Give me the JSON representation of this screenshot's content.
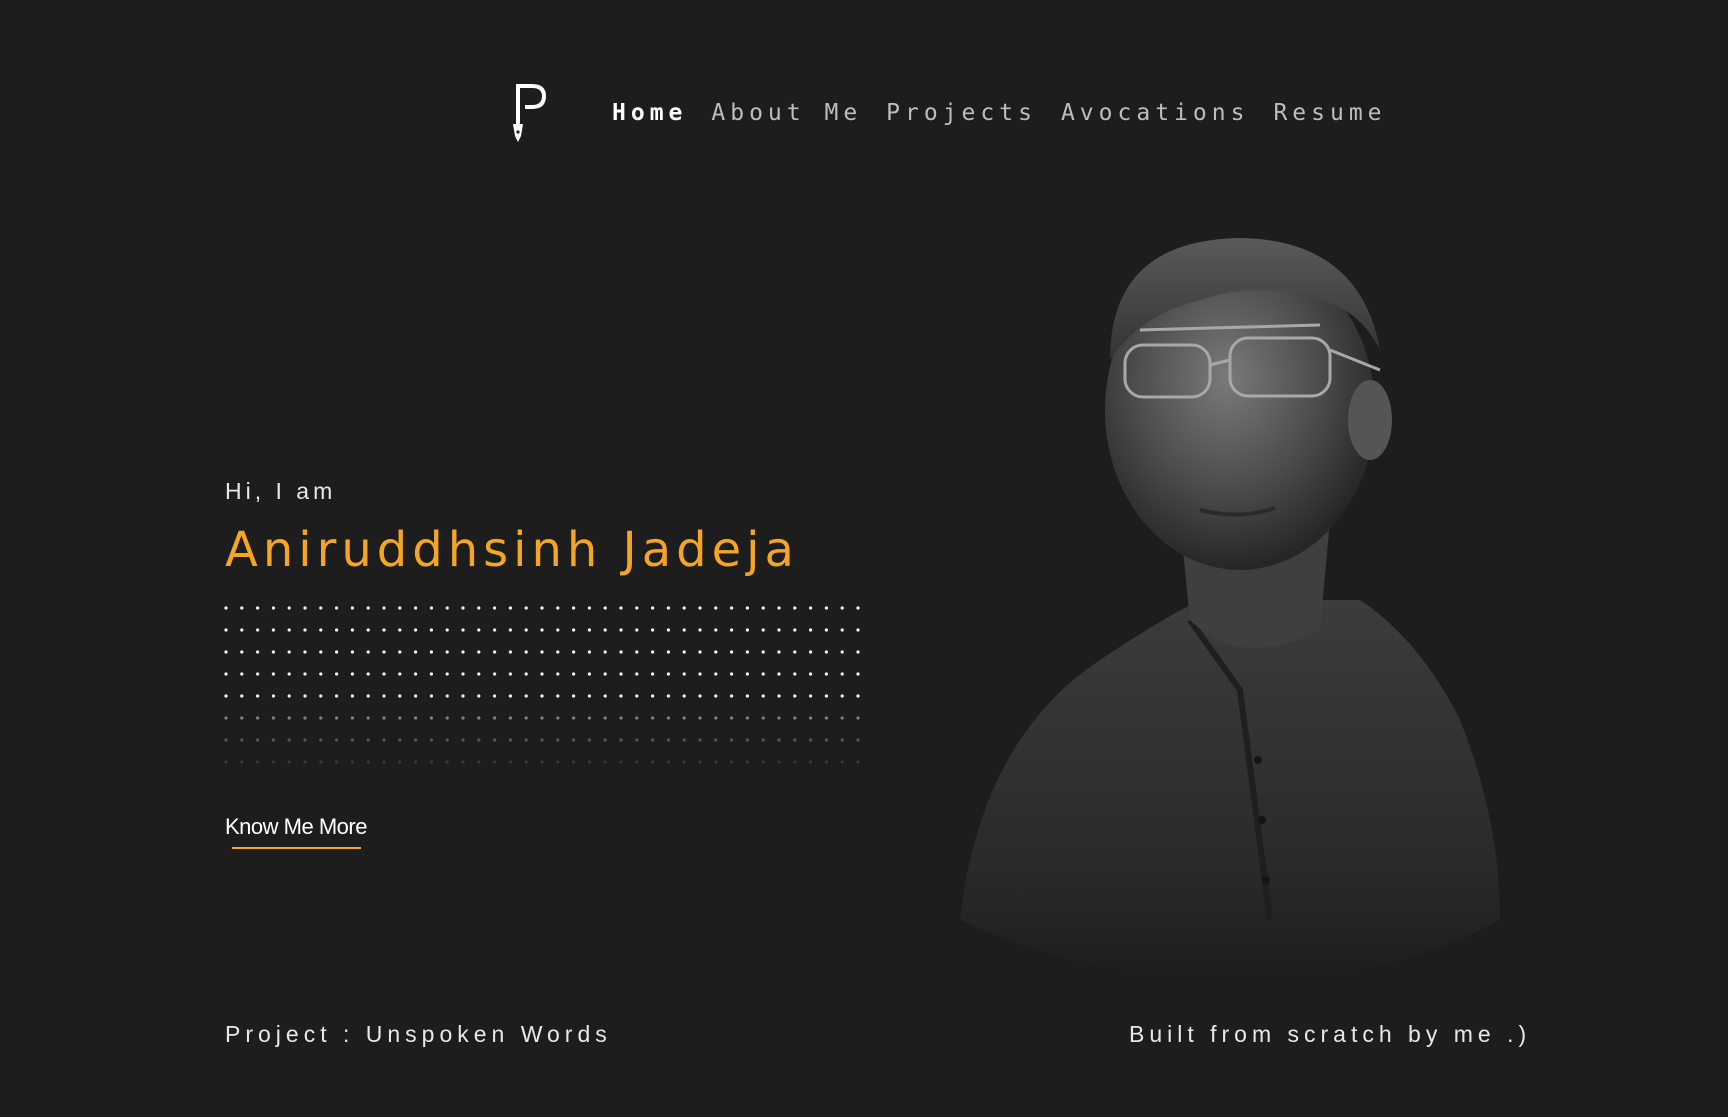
{
  "nav": {
    "logo_icon": "pen-nib-p-logo-icon",
    "items": [
      {
        "label": "Home",
        "active": true
      },
      {
        "label": "About Me",
        "active": false
      },
      {
        "label": "Projects",
        "active": false
      },
      {
        "label": "Avocations",
        "active": false
      },
      {
        "label": "Resume",
        "active": false
      }
    ]
  },
  "hero": {
    "greeting": "Hi, I am",
    "name": "Aniruddhsinh Jadeja",
    "cta_label": "Know Me More",
    "portrait_icon": "portrait-photo"
  },
  "footer": {
    "left": "Project : Unspoken Words",
    "right": "Built from scratch by me .)"
  },
  "colors": {
    "background": "#1d1d1d",
    "accent": "#f5a524",
    "text": "#ffffff",
    "nav_inactive": "#bdbdbd"
  }
}
